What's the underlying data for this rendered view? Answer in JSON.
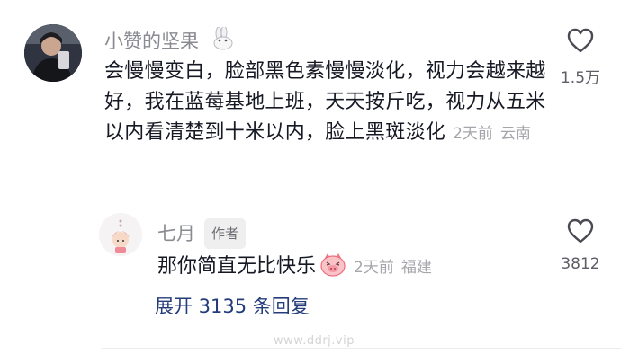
{
  "comment": {
    "username": "小赞的坚果",
    "text": "会慢慢变白，脸部黑色素慢慢淡化，视力会越来越好，我在蓝莓基地上班，天天按斤吃，视力从五米以内看清楚到十米以内，脸上黑斑淡化",
    "time": "2天前",
    "location": "云南",
    "likes": "1.5万"
  },
  "reply": {
    "username": "七月",
    "badge": "作者",
    "text": "那你简直无比快乐",
    "time": "2天前",
    "location": "福建",
    "likes": "3812"
  },
  "expand_label": "展开 3135 条回复",
  "watermark": "www.ddrj.vip",
  "colors": {
    "name_gray": "#8a8b91",
    "meta_gray": "#a5a6ab",
    "link_blue": "#243c7a"
  }
}
